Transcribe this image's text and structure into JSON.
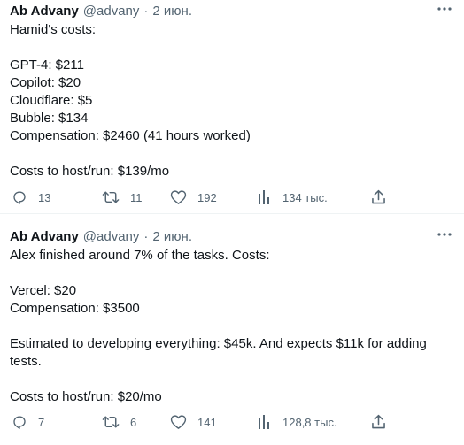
{
  "tweets": [
    {
      "author_name": "Ab Advany",
      "handle": "@advany",
      "separator": "·",
      "date": "2 июн.",
      "lines": [
        "Hamid's costs:",
        "",
        "GPT-4: $211",
        "Copilot: $20",
        "Cloudflare: $5",
        "Bubble: $134",
        "Compensation: $2460 (41 hours worked)",
        "",
        "Costs to host/run: $139/mo"
      ],
      "actions": {
        "replies": "13",
        "retweets": "11",
        "likes": "192",
        "views": "134 тыс."
      }
    },
    {
      "author_name": "Ab Advany",
      "handle": "@advany",
      "separator": "·",
      "date": "2 июн.",
      "lines": [
        "Alex finished around 7% of the tasks. Costs:",
        "",
        "Vercel: $20",
        "Compensation: $3500",
        "",
        "Estimated to developing everything: $45k. And expects $11k for adding tests.",
        "",
        "Costs to host/run: $20/mo"
      ],
      "actions": {
        "replies": "7",
        "retweets": "6",
        "likes": "141",
        "views": "128,8 тыс."
      }
    }
  ],
  "icons": {
    "more": "more-horizontal-icon",
    "reply": "reply-icon",
    "retweet": "retweet-icon",
    "like": "heart-icon",
    "views": "views-chart-icon",
    "share": "share-icon"
  },
  "colors": {
    "text": "#0f1419",
    "secondary": "#536471",
    "divider": "#eff3f4"
  }
}
